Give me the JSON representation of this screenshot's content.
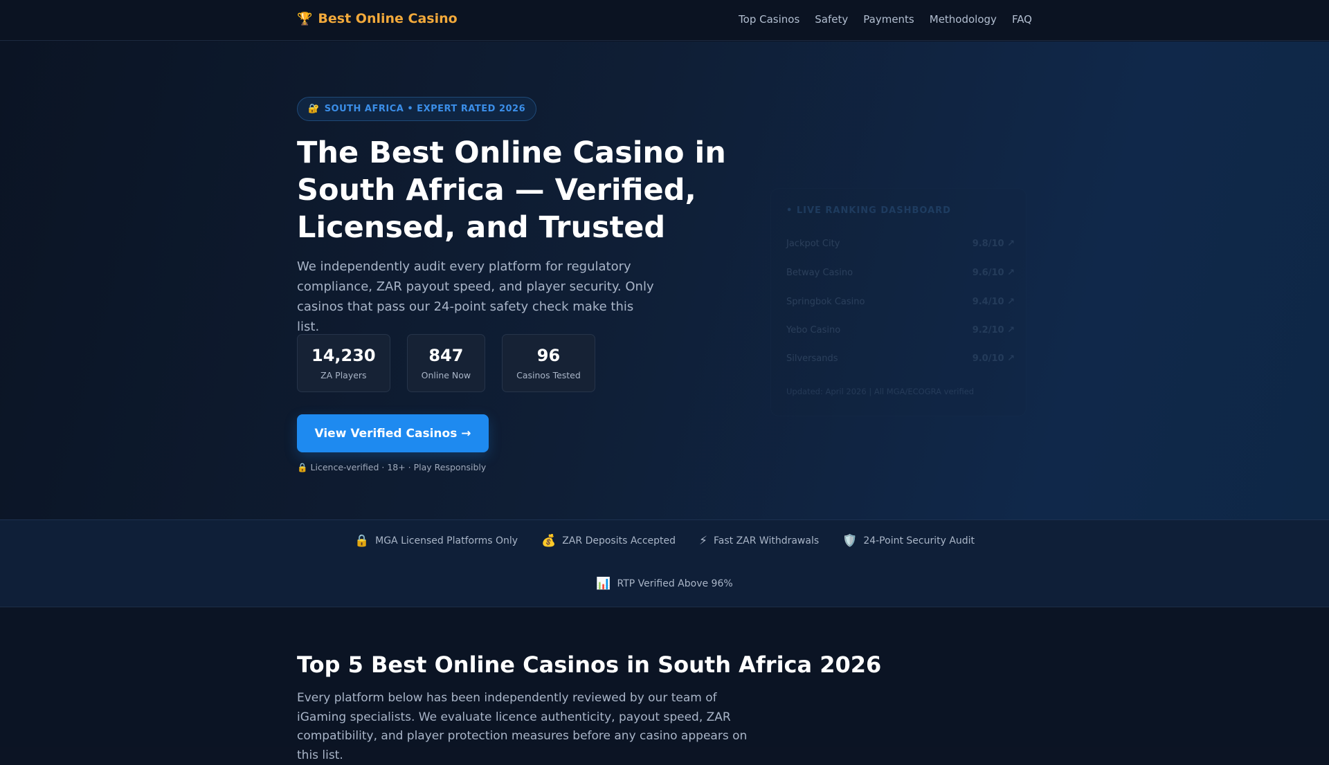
{
  "brand": {
    "icon": "trophy-icon",
    "glyph": "🏆",
    "name": "Best Online Casino",
    "color": "#f2a93b"
  },
  "nav": {
    "links": [
      "Top Casinos",
      "Safety",
      "Payments",
      "Methodology",
      "FAQ"
    ]
  },
  "hero": {
    "badge_icon": "🔐",
    "badge": "SOUTH AFRICA • EXPERT RATED 2026",
    "title": "The Best Online Casino in South Africa — Verified, Licensed, and Trusted",
    "subtitle": "We independently audit every platform for regulatory compliance, ZAR payout speed, and player security. Only casinos that pass our 24-point safety check make this list.",
    "stats": [
      {
        "value": "14,230",
        "label": "ZA Players"
      },
      {
        "value": "847",
        "label": "Online Now"
      },
      {
        "value": "96",
        "label": "Casinos Tested"
      }
    ],
    "cta": "View Verified Casinos →",
    "cta_note": "🔒 Licence-verified · 18+ · Play Responsibly",
    "accent": "#1e8af0"
  },
  "dashboard": {
    "title": "• LIVE RANKING DASHBOARD",
    "rows": [
      {
        "name": "Jackpot City",
        "score": "9.8/10 ↗"
      },
      {
        "name": "Betway Casino",
        "score": "9.6/10 ↗"
      },
      {
        "name": "Springbok Casino",
        "score": "9.4/10 ↗"
      },
      {
        "name": "Yebo Casino",
        "score": "9.2/10 ↗"
      },
      {
        "name": "Silversands",
        "score": "9.0/10 ↗"
      }
    ],
    "footer": "Updated: April 2026 | All MGA/ECOGRA verified"
  },
  "trust": {
    "items": [
      {
        "icon": "lock-icon",
        "glyph": "🔒",
        "label": "MGA Licensed Platforms Only"
      },
      {
        "icon": "money-bag-icon",
        "glyph": "💰",
        "label": "ZAR Deposits Accepted"
      },
      {
        "icon": "lightning-icon",
        "glyph": "⚡",
        "label": "Fast ZAR Withdrawals"
      },
      {
        "icon": "shield-icon",
        "glyph": "🛡️",
        "label": "24-Point Security Audit"
      },
      {
        "icon": "bar-chart-icon",
        "glyph": "📊",
        "label": "RTP Verified Above 96%"
      }
    ]
  },
  "top5": {
    "title": "Top 5 Best Online Casinos in South Africa 2026",
    "body": "Every platform below has been independently reviewed by our team of iGaming specialists. We evaluate licence authenticity, payout speed, ZAR compatibility, and player protection measures before any casino appears on this list."
  }
}
